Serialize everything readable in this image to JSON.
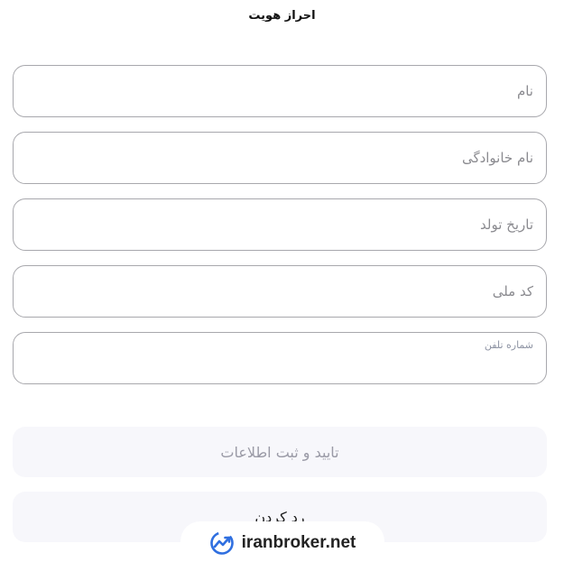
{
  "header": {
    "title": "احراز هویت"
  },
  "form": {
    "first_name_placeholder": "نام",
    "last_name_placeholder": "نام خانوادگی",
    "birth_date_placeholder": "تاریخ تولد",
    "national_code_placeholder": "کد ملی",
    "phone_label": "شماره تلفن"
  },
  "actions": {
    "confirm_label": "تایید و ثبت اطلاعات",
    "cancel_label": "رد کردن"
  },
  "watermark": {
    "text": "iranbroker.net",
    "icon": "trend-chart-icon"
  },
  "colors": {
    "field_border": "#a8a8ad",
    "button_bg": "#f7f7fb",
    "logo_blue": "#2f6fe0"
  }
}
